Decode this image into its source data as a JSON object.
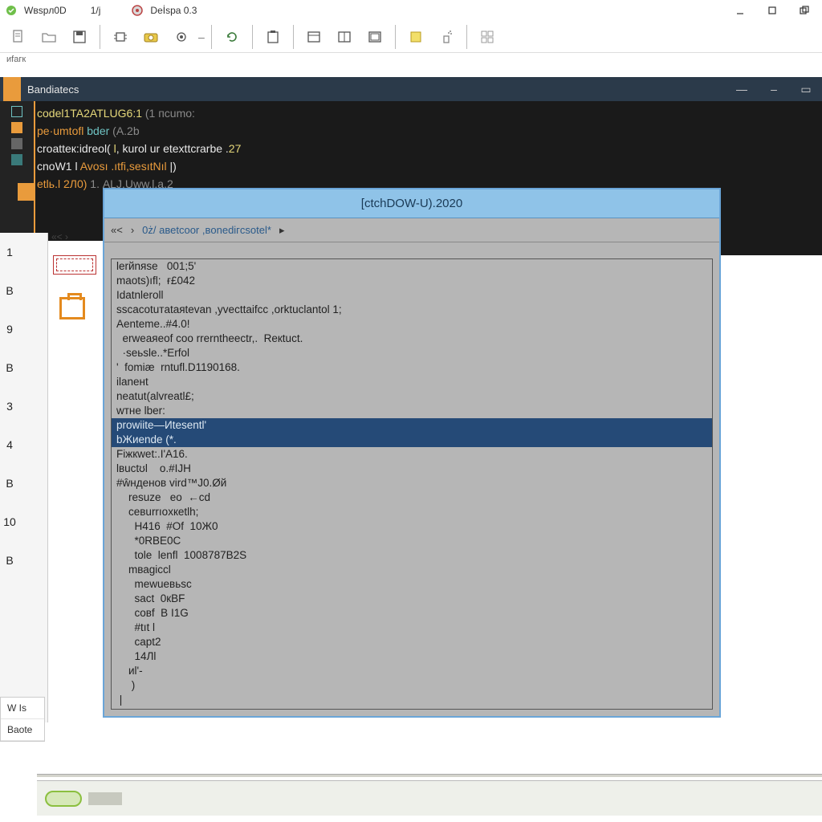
{
  "top": {
    "app1_title": "Wвspл0D",
    "app1_num": "1/j",
    "app2_title": "Dеİspa 0.3"
  },
  "sub_label": "иfaгк",
  "dark": {
    "tab_title": "Bandiatecs",
    "lines": [
      [
        [
          "tok-y",
          "codel1TA2ATLUG6:1 "
        ],
        [
          "tok-g",
          "(1 пcumo:"
        ]
      ],
      [
        [
          "tok-o",
          "pe·umtofl  "
        ],
        [
          "tok-c",
          "bder  "
        ],
        [
          "tok-g",
          "(A.2b"
        ]
      ],
      [
        [
          "tok-w",
          "croаtteк:idreоl(   "
        ],
        [
          "tok-y",
          "l"
        ],
        [
          "tok-w",
          ",  kurоl  ur  etexttсrarbe ."
        ],
        [
          "tok-y",
          "27"
        ]
      ],
      [
        [
          "tok-w",
          "cnоW1 l   "
        ],
        [
          "tok-o",
          "Avosı .ıtfi,sеsıtNıl"
        ],
        [
          "tok-w",
          "   |)"
        ]
      ],
      [
        [
          "tok-o",
          "etlь.l 2Л0) "
        ],
        [
          "tok-g",
          " 1. ALJ.Uww.l.a.2"
        ]
      ]
    ]
  },
  "left": {
    "nums": [
      "1",
      "B",
      "9",
      "B",
      "3",
      "4",
      "B",
      "10",
      "B"
    ],
    "bcol": [
      "",
      "",
      "",
      "",
      "",
      "",
      "",
      "",
      ""
    ],
    "arrows": "«˂  ›"
  },
  "modal": {
    "title": "[ctchDOW-U).2020",
    "toolbar_text": "0ż/ авеtcoor ,вonediгcsоtel*",
    "lines": [
      "lerйnяse   001;5'",
      "mаots)ıfl;  ғ£042",
      "Idаtnleroll",
      "sscacоtuтataяtevan ,yvecttaifсc ,orktuсlantоl 1;",
      "Aenteme..#4.0!",
      "  erweaяeof coо rrerntheectr,.  Reкtuct.",
      "  ·seьsle..*Erfоl",
      "'  fomiæ  rntufl.D1190168.",
      "ilаnенt",
      "neаtut(alvreаtl£;",
      "wтнe lber:",
      "prowiite—Иtesentl'",
      "bЖиеnde (*.",
      "Fiжкwеt:.I'A16.",
      "lвuctʊl    o.#IJH",
      "#ŵнденов vird™J0.Øй",
      "    resuzе   eо  ←cd",
      "    cевurrıоxкetlh;",
      "      H416  #Of  10Ж0",
      "      *0RBE0C",
      "      tоle  lenfl  1008787В2S",
      "    mваgicсl",
      "      mеwueвьsc",
      "      sасt  0кBF",
      "      cовf  B I1G",
      "      #tıt l",
      "      cарt2",
      "      14Лl",
      "    иl'-",
      "     )",
      " |"
    ],
    "selected_idx": [
      11,
      12
    ]
  },
  "bottom_left": {
    "items": [
      "W Is",
      "Bаotе"
    ]
  }
}
